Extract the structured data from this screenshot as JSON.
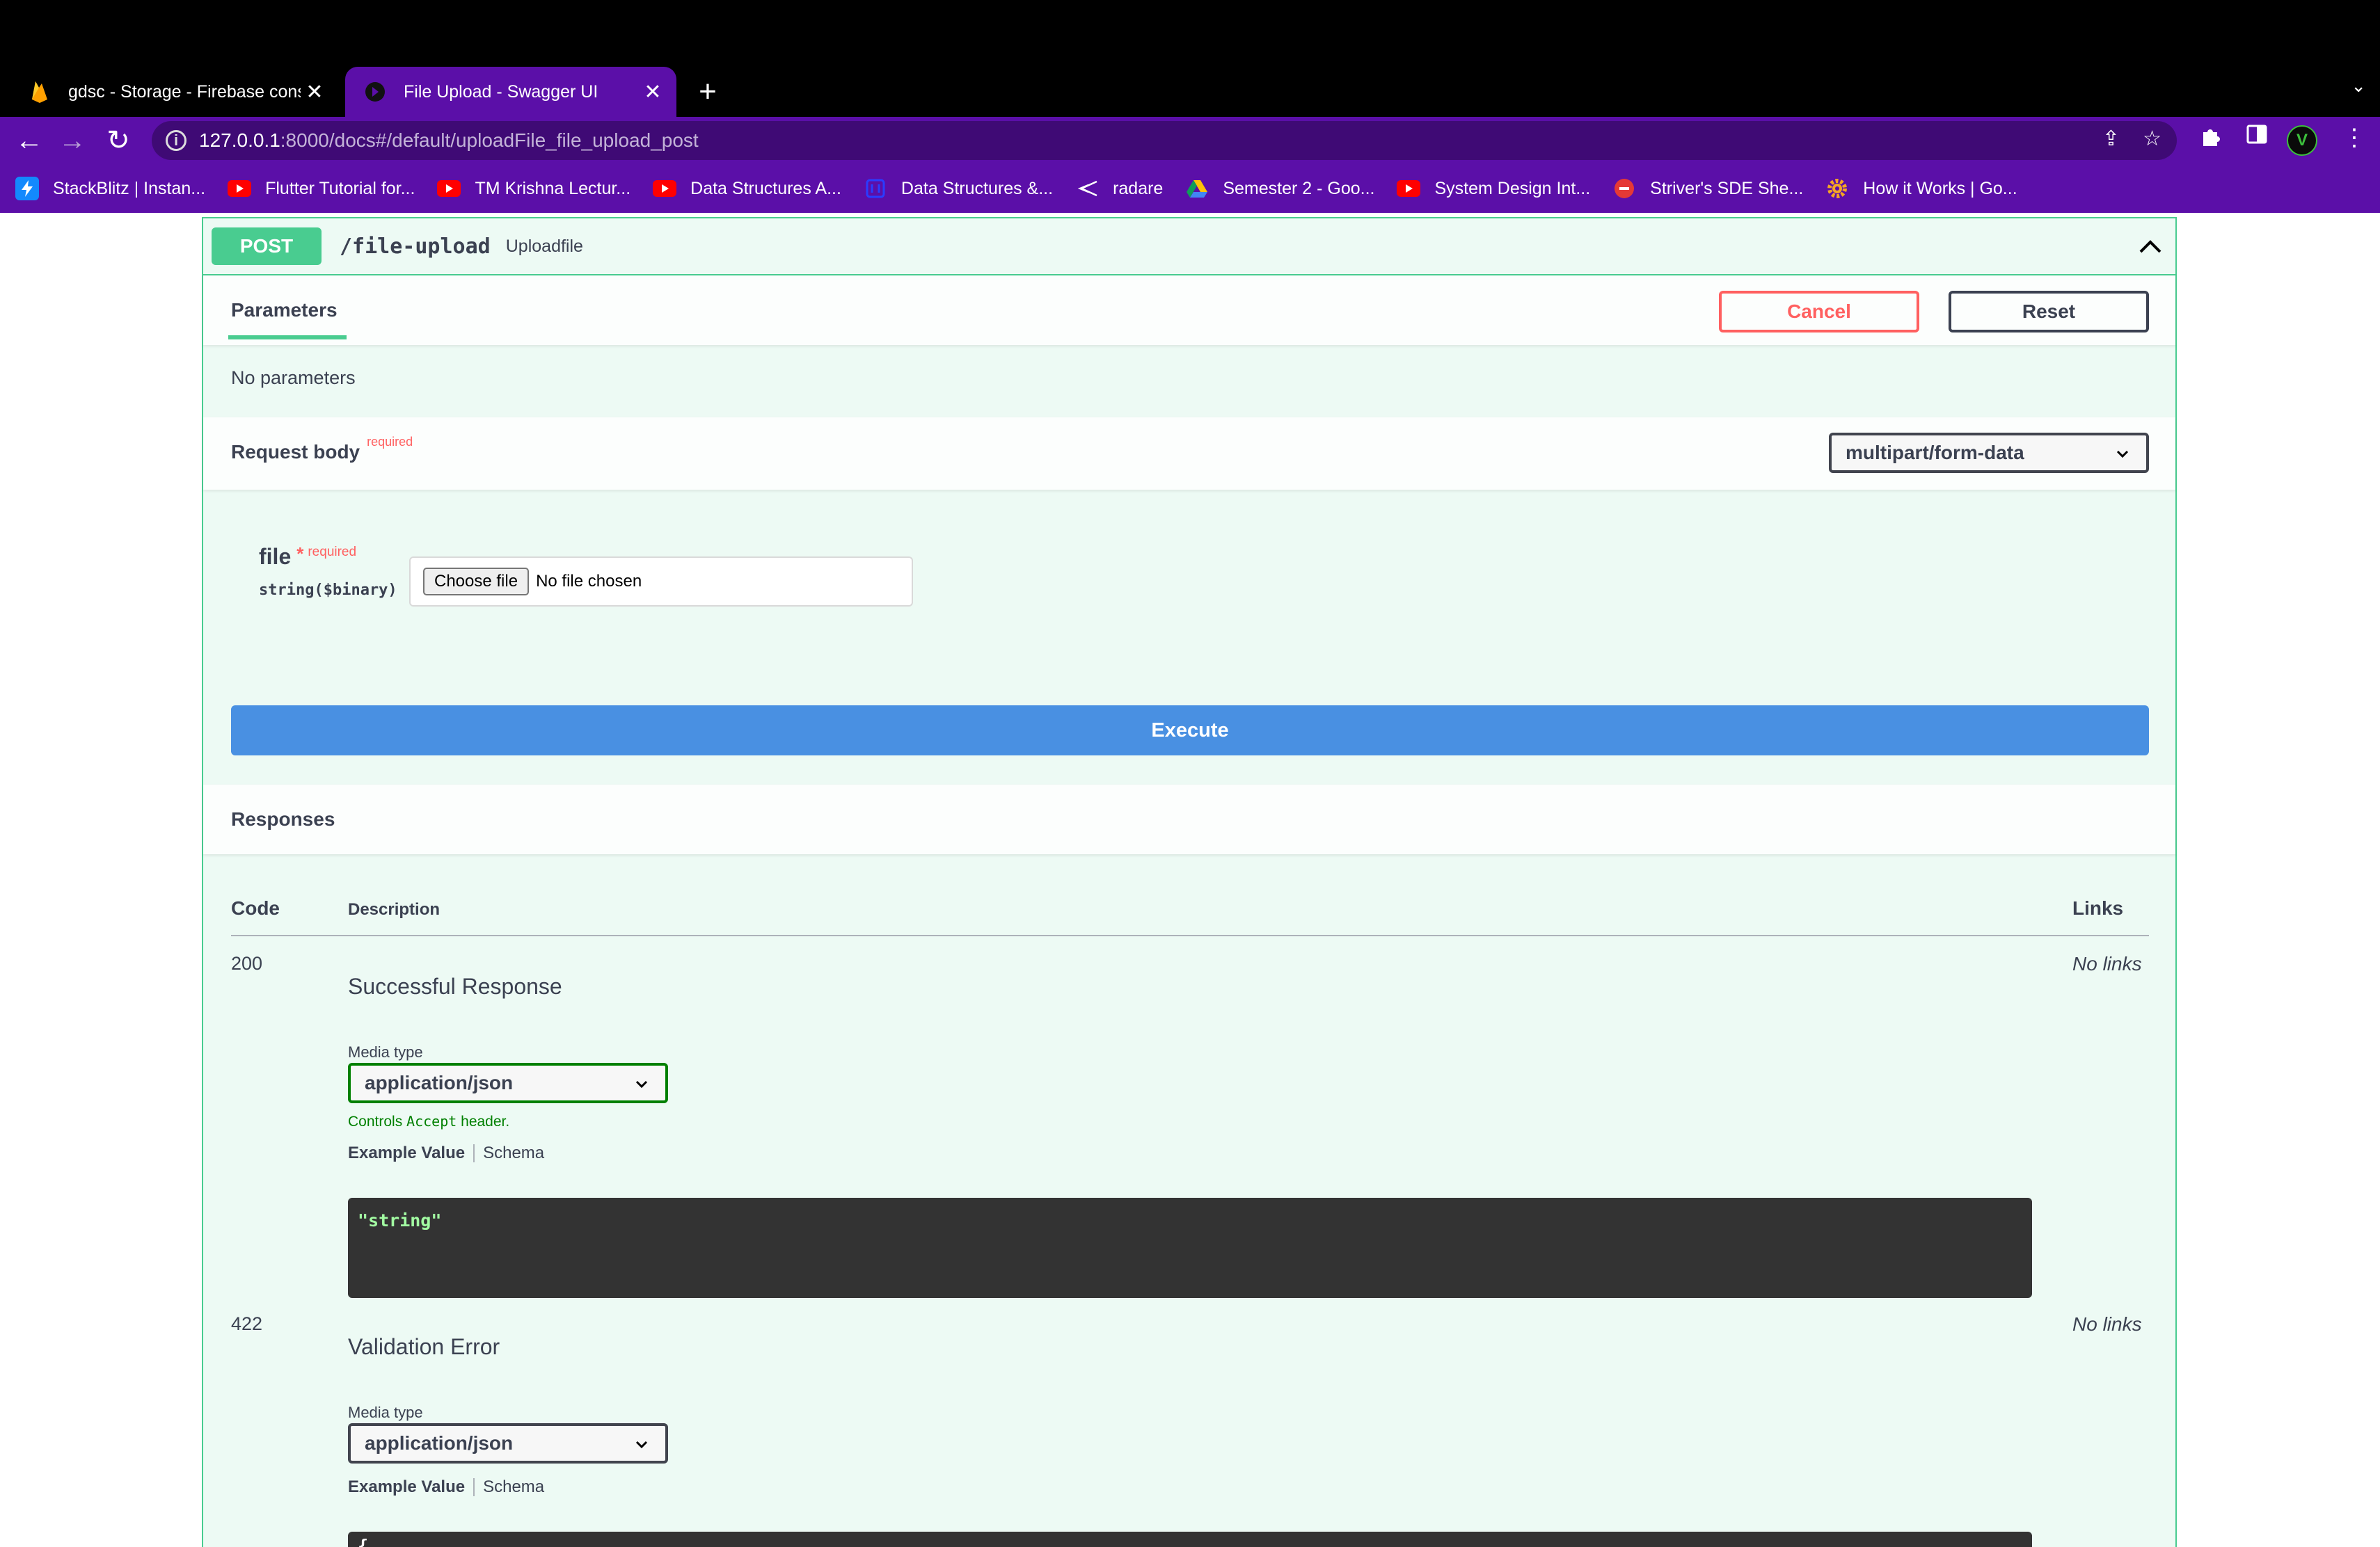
{
  "browser": {
    "tabs": [
      {
        "title": "gdsc - Storage - Firebase console",
        "active": false,
        "icon": "firebase-icon"
      },
      {
        "title": "File Upload - Swagger UI",
        "active": true,
        "icon": "swagger-icon"
      }
    ],
    "url_host": "127.0.0.1",
    "url_rest": ":8000/docs#/default/uploadFile_file_upload_post",
    "avatar_letter": "V",
    "bookmarks": [
      {
        "label": "StackBlitz | Instan...",
        "icon": "stackblitz-icon"
      },
      {
        "label": "Flutter Tutorial for...",
        "icon": "youtube-icon"
      },
      {
        "label": "TM Krishna Lectur...",
        "icon": "youtube-icon"
      },
      {
        "label": "Data Structures A...",
        "icon": "youtube-icon"
      },
      {
        "label": "Data Structures &...",
        "icon": "cn-icon"
      },
      {
        "label": "radare",
        "icon": "radare-icon"
      },
      {
        "label": "Semester 2 - Goo...",
        "icon": "google-drive-icon"
      },
      {
        "label": "System Design Int...",
        "icon": "youtube-icon"
      },
      {
        "label": "Striver's SDE She...",
        "icon": "tuf-icon"
      },
      {
        "label": "How it Works | Go...",
        "icon": "gear-bookmark-icon"
      }
    ]
  },
  "operation": {
    "method": "POST",
    "path": "/file-upload",
    "summary": "Uploadfile"
  },
  "parameters": {
    "tab_label": "Parameters",
    "cancel_label": "Cancel",
    "reset_label": "Reset",
    "empty_text": "No parameters"
  },
  "request_body": {
    "label": "Request body",
    "required_label": "required",
    "content_type": "multipart/form-data",
    "field": {
      "name": "file",
      "star": "*",
      "required_label": "required",
      "type": "string($binary)",
      "choose_label": "Choose file",
      "no_file_label": "No file chosen"
    }
  },
  "execute_label": "Execute",
  "responses": {
    "label": "Responses",
    "columns": {
      "code": "Code",
      "description": "Description",
      "links": "Links"
    },
    "media_type_label": "Media type",
    "controls_prefix": "Controls",
    "controls_code": "Accept",
    "controls_suffix": "header.",
    "example_value_label": "Example Value",
    "schema_label": "Schema",
    "rows": [
      {
        "code": "200",
        "description": "Successful Response",
        "media_type": "application/json",
        "links": "No links",
        "example": "\"string\""
      },
      {
        "code": "422",
        "description": "Validation Error",
        "media_type": "application/json",
        "links": "No links",
        "example": "{"
      }
    ]
  },
  "colors": {
    "post_accent": "#49cc90",
    "execute": "#4990e2",
    "cancel": "#ff6060",
    "browser_theme": "#5b0fa8"
  }
}
